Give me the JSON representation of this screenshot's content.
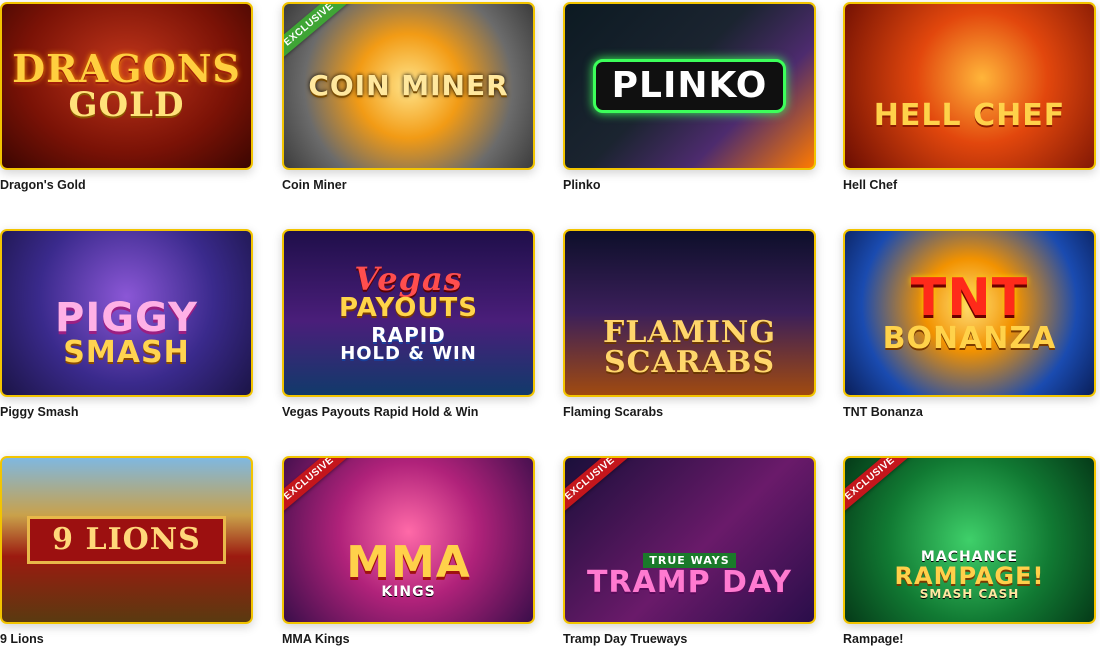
{
  "badges": {
    "exclusive": "EXCLUSIVE"
  },
  "games": [
    {
      "title": "Dragon's Gold",
      "art": [
        "DRAGONS",
        "GOLD"
      ],
      "exclusive": false
    },
    {
      "title": "Coin Miner",
      "art": [
        "COIN MINER"
      ],
      "exclusive": true
    },
    {
      "title": "Plinko",
      "art": [
        "PLINKO"
      ],
      "exclusive": false
    },
    {
      "title": "Hell Chef",
      "art": [
        "HELL CHEF"
      ],
      "exclusive": false
    },
    {
      "title": "Piggy Smash",
      "art": [
        "PIGGY",
        "SMASH"
      ],
      "exclusive": false
    },
    {
      "title": "Vegas Payouts Rapid Hold & Win",
      "art": [
        "Vegas",
        "PAYOUTS",
        "RAPID",
        "HOLD & WIN"
      ],
      "exclusive": false
    },
    {
      "title": "Flaming Scarabs",
      "art": [
        "FLAMING",
        "SCARABS"
      ],
      "exclusive": false
    },
    {
      "title": "TNT Bonanza",
      "art": [
        "TNT",
        "BONANZA"
      ],
      "exclusive": false
    },
    {
      "title": "9 Lions",
      "art": [
        "9 LIONS"
      ],
      "exclusive": false
    },
    {
      "title": "MMA Kings",
      "art": [
        "MMA",
        "KINGS"
      ],
      "exclusive": true
    },
    {
      "title": "Tramp Day Trueways",
      "art": [
        "TRUE WAYS",
        "TRAMP DAY"
      ],
      "exclusive": true
    },
    {
      "title": "Rampage!",
      "art": [
        "MACHANCE",
        "RAMPAGE!",
        "SMASH CASH"
      ],
      "exclusive": true
    }
  ],
  "colors": {
    "tile_border": "#f2c400",
    "badge_green": "#3fa535",
    "badge_red": "#c4161c",
    "title_text": "#1a1a1a"
  }
}
